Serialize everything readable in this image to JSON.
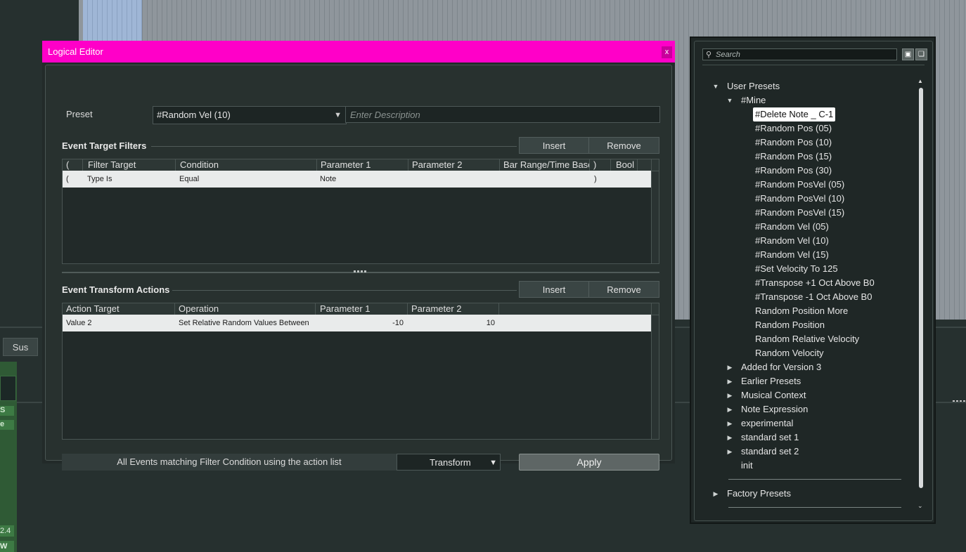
{
  "background": {
    "sus_label": "Sus",
    "green_labels": [
      "S",
      "e"
    ],
    "meter_value": "2.4",
    "meter_w": "W"
  },
  "dialog": {
    "title": "Logical Editor",
    "close_glyph": "x",
    "preset_label": "Preset",
    "preset_value": "#Random Vel (10)",
    "dropdown_glyph": "▼",
    "description_placeholder": "Enter Description",
    "filters": {
      "title": "Event Target Filters",
      "insert_label": "Insert",
      "remove_label": "Remove",
      "columns": [
        "(",
        "Filter Target",
        "Condition",
        "Parameter 1",
        "Parameter 2",
        "Bar Range/Time Base",
        ")",
        "Bool"
      ],
      "rows": [
        {
          "open": "(",
          "target": "Type Is",
          "condition": "Equal",
          "p1": "Note",
          "p2": "",
          "range": "",
          "close": ")",
          "bool": ""
        }
      ]
    },
    "actions": {
      "title": "Event Transform Actions",
      "insert_label": "Insert",
      "remove_label": "Remove",
      "columns": [
        "Action Target",
        "Operation",
        "Parameter 1",
        "Parameter 2"
      ],
      "rows": [
        {
          "target": "Value 2",
          "operation": "Set Relative Random Values Between",
          "p1": "-10",
          "p2": "10"
        }
      ]
    },
    "status_text": "All Events matching Filter Condition using the action list",
    "mode_value": "Transform",
    "apply_label": "Apply"
  },
  "panel": {
    "search_placeholder": "Search",
    "user_presets_label": "User Presets",
    "mine_label": "#Mine",
    "mine_items": [
      "#Delete Note _ C-1",
      "#Random Pos (05)",
      "#Random Pos (10)",
      "#Random Pos (15)",
      "#Random Pos (30)",
      "#Random PosVel (05)",
      "#Random PosVel (10)",
      "#Random PosVel (15)",
      "#Random Vel (05)",
      "#Random Vel (10)",
      "#Random Vel (15)",
      "#Set Velocity To 125",
      "#Transpose +1 Oct Above B0",
      "#Transpose -1 Oct Above B0",
      "Random Position More",
      "Random Position",
      "Random Relative Velocity",
      "Random Velocity"
    ],
    "selected_item": "#Delete Note _ C-1",
    "folders": [
      "Added for Version 3",
      "Earlier Presets",
      "Musical Context",
      "Note Expression",
      "experimental",
      "standard set 1",
      "standard set 2"
    ],
    "init_label": "init",
    "factory_label": "Factory Presets"
  }
}
